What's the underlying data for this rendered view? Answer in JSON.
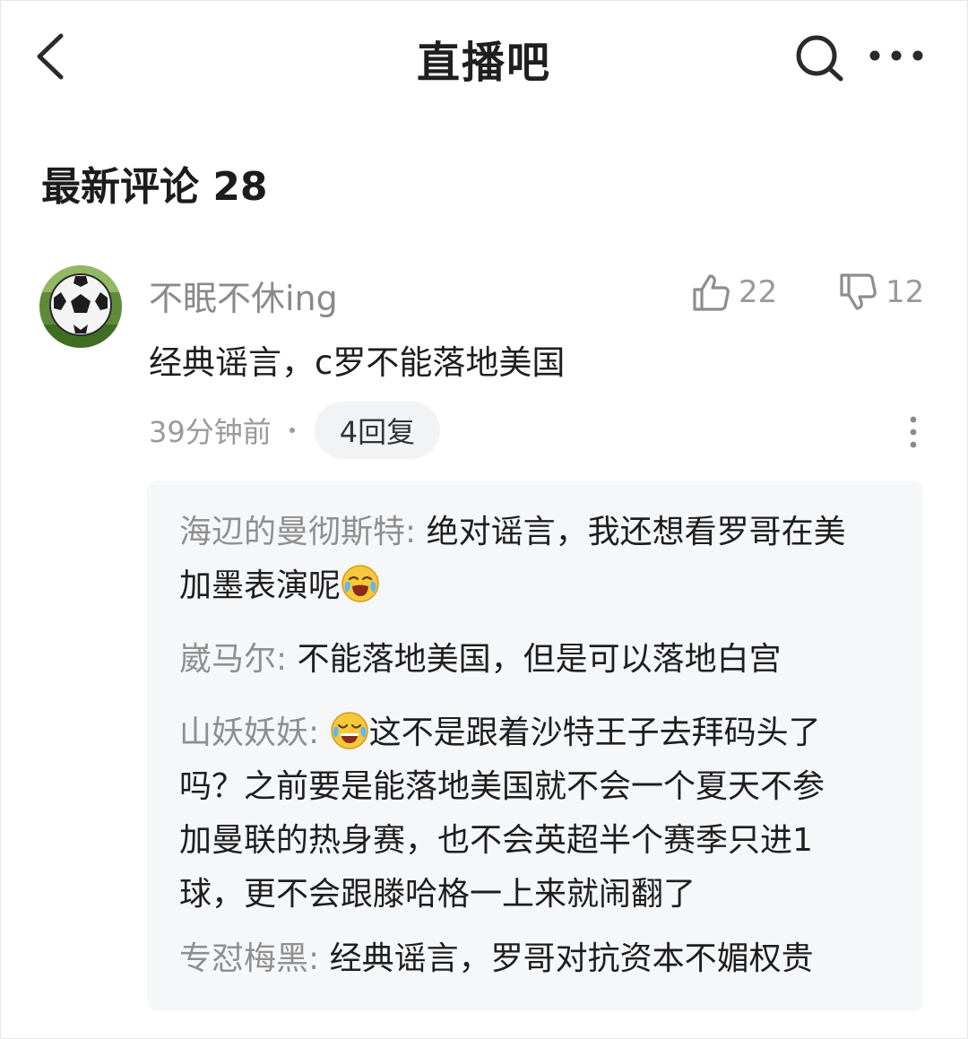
{
  "header": {
    "title": "直播吧"
  },
  "section": {
    "title": "最新评论 28"
  },
  "comment": {
    "username": "不眠不休ing",
    "text": "经典谣言，c罗不能落地美国",
    "likes": "22",
    "dislikes": "12",
    "time": "39分钟前",
    "reply_count_label": "4回复"
  },
  "replies": [
    {
      "name": "海辺的曼彻斯特",
      "sep": ":",
      "before": "绝对谣言，我还想看罗哥在美",
      "line2": "加墨表演呢",
      "emoji": "cry-laugh-emoji"
    },
    {
      "name": "崴马尔",
      "sep": ":",
      "text": "不能落地美国，但是可以落地白宫"
    },
    {
      "name": "山妖妖妖",
      "sep": ":",
      "emoji": "tears-of-joy-emoji",
      "line1": "这不是跟着沙特王子去拜码头了",
      "line2": "吗？之前要是能落地美国就不会一个夏天不参",
      "line3": "加曼联的热身赛，也不会英超半个赛季只进1",
      "line4": "球，更不会跟滕哈格一上来就闹翻了"
    },
    {
      "name": "专怼梅黑",
      "sep": ":",
      "text": "经典谣言，罗哥对抗资本不媚权贵"
    }
  ],
  "icons": {
    "back": "chevron-left-icon",
    "search": "search-icon",
    "more": "more-horizontal-icon",
    "like": "thumbs-up-icon",
    "dislike": "thumbs-down-icon",
    "options": "more-vertical-icon",
    "avatar": "soccer-ball-avatar"
  },
  "colors": {
    "panel_bg": "#f6f7f9",
    "muted_text": "#8f8f8f",
    "pill_bg": "#f2f3f5"
  }
}
